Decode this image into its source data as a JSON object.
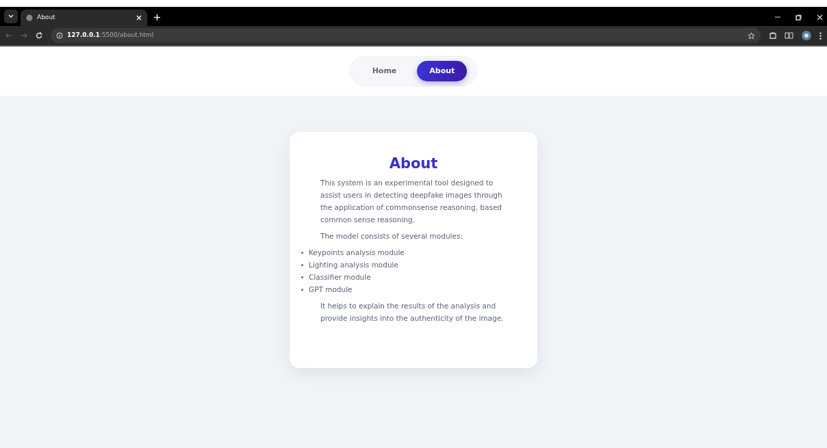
{
  "browser": {
    "tab_title": "About",
    "url_host": "127.0.0.1",
    "url_rest": ":5500/about.html"
  },
  "nav": [
    {
      "label": "Home",
      "selected": false
    },
    {
      "label": "About",
      "selected": true
    }
  ],
  "card": {
    "title": "About",
    "intro": "This system is an experimental tool designed to assist users in detecting deepfake images through the application of commonsense reasoning, based common sense reasoning.",
    "modules_intro": "The model consists of several modules:",
    "modules": [
      "Keypoints analysis module",
      "Lighting analysis module",
      "Classifier module",
      "GPT module"
    ],
    "outro": "It helps to explain the results of the analysis and provide insights into the authenticity of the image."
  }
}
